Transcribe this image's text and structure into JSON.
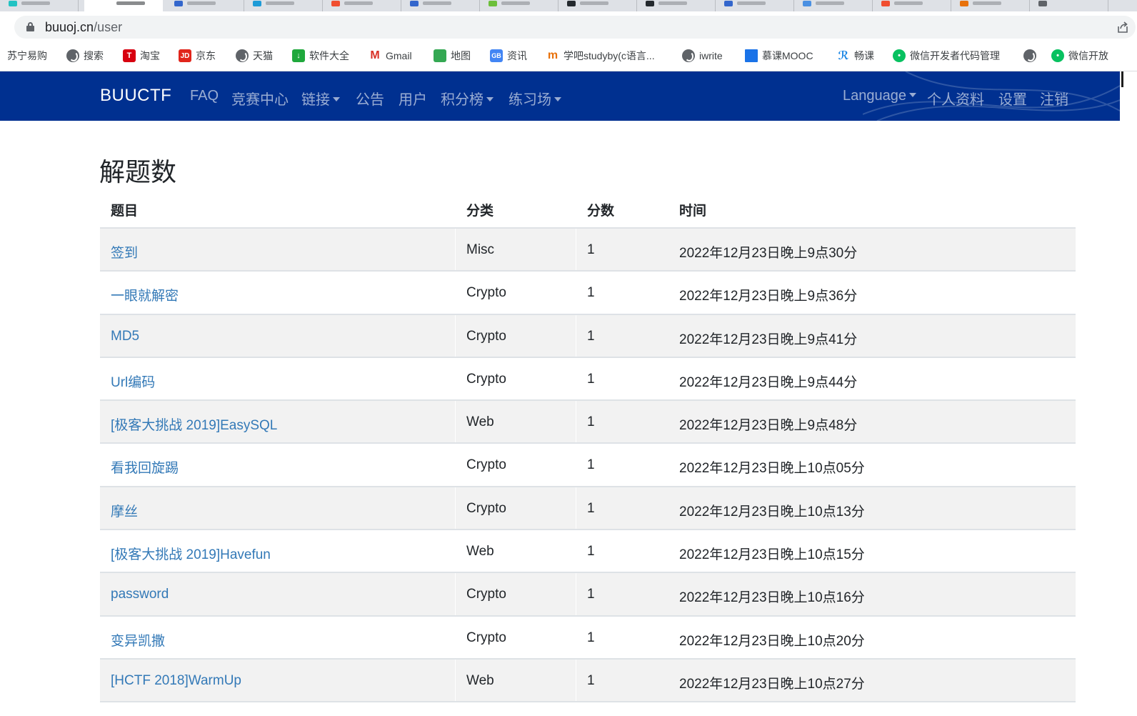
{
  "browser": {
    "url_host": "buuoj.cn",
    "url_path": "/user"
  },
  "bookmarks": [
    {
      "label": "苏宁易购",
      "icon": "suning-icon"
    },
    {
      "label": "搜索",
      "icon": "globe-icon"
    },
    {
      "label": "淘宝",
      "icon": "tmall-icon"
    },
    {
      "label": "京东",
      "icon": "jd-icon"
    },
    {
      "label": "天猫",
      "icon": "globe-icon"
    },
    {
      "label": "软件大全",
      "icon": "download-icon"
    },
    {
      "label": "Gmail",
      "icon": "gmail-icon"
    },
    {
      "label": "地图",
      "icon": "map-icon"
    },
    {
      "label": "资讯",
      "icon": "news-icon"
    },
    {
      "label": "学吧studyby(c语言...",
      "icon": "studyby-icon"
    },
    {
      "label": "iwrite",
      "icon": "globe-icon"
    },
    {
      "label": "慕课MOOC",
      "icon": "mooc-icon"
    },
    {
      "label": "畅课",
      "icon": "changke-icon"
    },
    {
      "label": "微信开发者代码管理",
      "icon": "wechat-icon"
    },
    {
      "label": "",
      "icon": "globe-icon"
    },
    {
      "label": "微信开放",
      "icon": "wechat-icon"
    }
  ],
  "navbar": {
    "brand": "BUUCTF",
    "links": [
      "FAQ",
      "竞赛中心",
      "链接",
      "公告",
      "用户",
      "积分榜",
      "练习场"
    ],
    "right_links": [
      "Language",
      "个人资料",
      "设置",
      "注销"
    ],
    "bg_color": "#003090"
  },
  "page": {
    "title": "解题数"
  },
  "table": {
    "headers": [
      "题目",
      "分类",
      "分数",
      "时间"
    ],
    "rows": [
      {
        "title": "签到",
        "category": "Misc",
        "score": "1",
        "time": "2022年12月23日晚上9点30分"
      },
      {
        "title": "一眼就解密",
        "category": "Crypto",
        "score": "1",
        "time": "2022年12月23日晚上9点36分"
      },
      {
        "title": "MD5",
        "category": "Crypto",
        "score": "1",
        "time": "2022年12月23日晚上9点41分"
      },
      {
        "title": "Url编码",
        "category": "Crypto",
        "score": "1",
        "time": "2022年12月23日晚上9点44分"
      },
      {
        "title": "[极客大挑战 2019]EasySQL",
        "category": "Web",
        "score": "1",
        "time": "2022年12月23日晚上9点48分"
      },
      {
        "title": "看我回旋踢",
        "category": "Crypto",
        "score": "1",
        "time": "2022年12月23日晚上10点05分"
      },
      {
        "title": "摩丝",
        "category": "Crypto",
        "score": "1",
        "time": "2022年12月23日晚上10点13分"
      },
      {
        "title": "[极客大挑战 2019]Havefun",
        "category": "Web",
        "score": "1",
        "time": "2022年12月23日晚上10点15分"
      },
      {
        "title": "password",
        "category": "Crypto",
        "score": "1",
        "time": "2022年12月23日晚上10点16分"
      },
      {
        "title": "变异凯撒",
        "category": "Crypto",
        "score": "1",
        "time": "2022年12月23日晚上10点20分"
      },
      {
        "title": "[HCTF 2018]WarmUp",
        "category": "Web",
        "score": "1",
        "time": "2022年12月23日晚上10点27分"
      }
    ],
    "link_color": "#3379b7"
  }
}
